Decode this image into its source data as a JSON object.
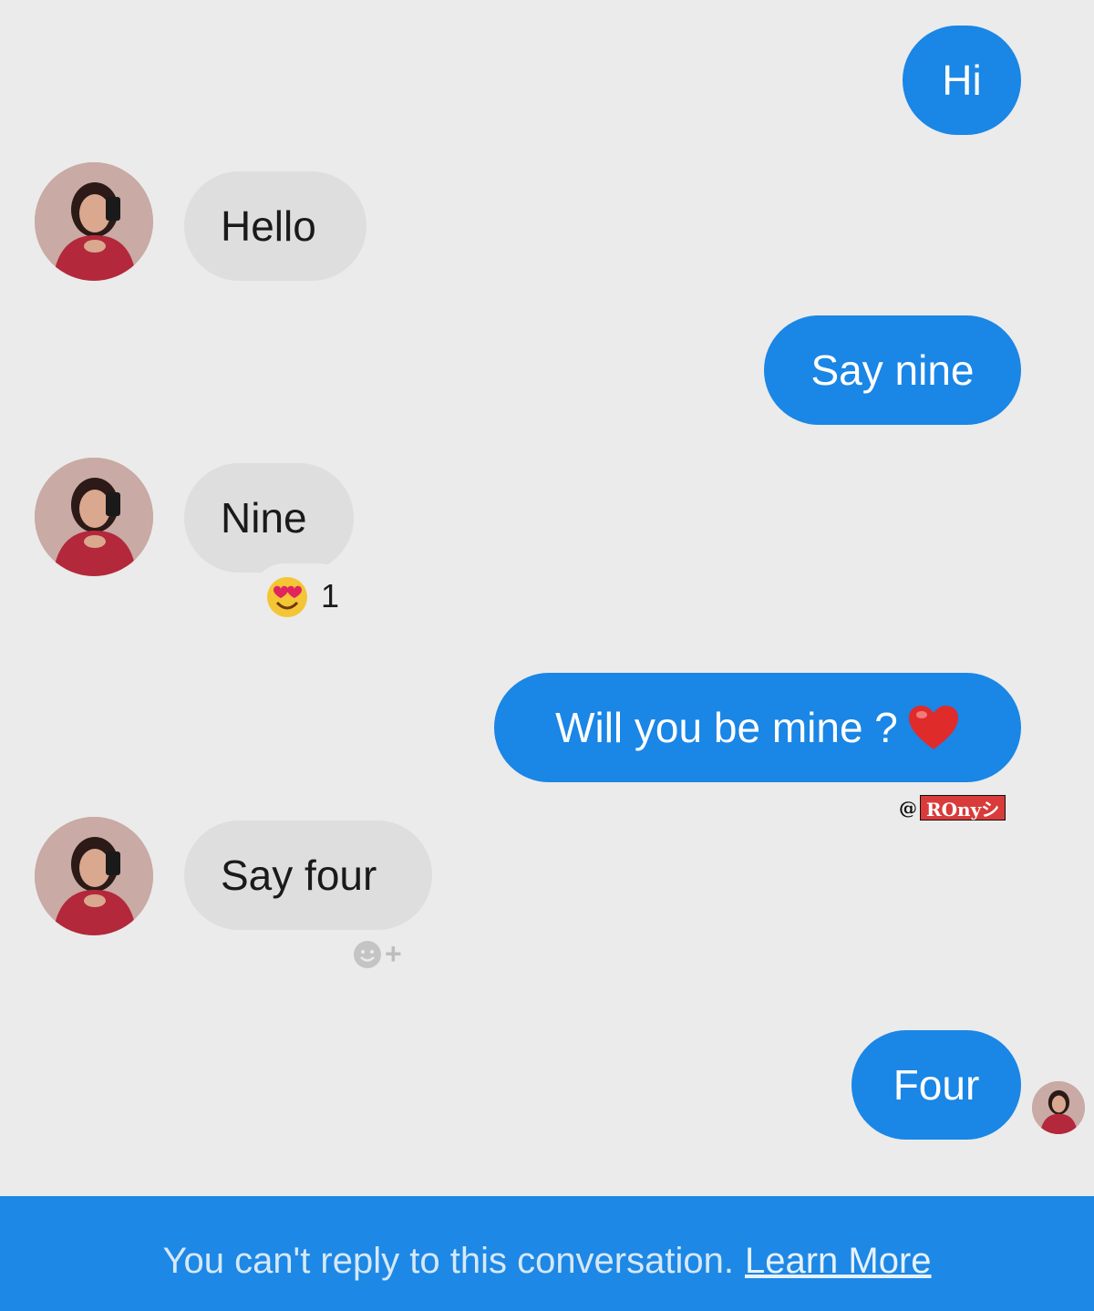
{
  "conversation": {
    "messages": [
      {
        "from": "me",
        "text": "Hi"
      },
      {
        "from": "them",
        "text": "Hello"
      },
      {
        "from": "me",
        "text": "Say nine"
      },
      {
        "from": "them",
        "text": "Nine",
        "reaction": {
          "emoji": "heart-eyes-emoji",
          "count": "1"
        }
      },
      {
        "from": "me",
        "text": "Will you be mine ?"
      },
      {
        "from": "them",
        "text": "Say four",
        "add_reaction": "+"
      },
      {
        "from": "me",
        "text": "Four"
      }
    ]
  },
  "watermark": {
    "at": "@",
    "handle": "ROnyシ"
  },
  "footer": {
    "notice": "You can't reply to this conversation.",
    "link": "Learn More"
  },
  "colors": {
    "sent_bubble": "#1a86e6",
    "received_bubble": "#dedede",
    "background": "#ebebeb",
    "footer_bar": "#1d88e5"
  },
  "icons": {
    "reaction": "heart-eyes-emoji",
    "heart": "red-heart-emoji",
    "add_reaction": "add-reaction-icon",
    "avatar": "contact-avatar"
  }
}
